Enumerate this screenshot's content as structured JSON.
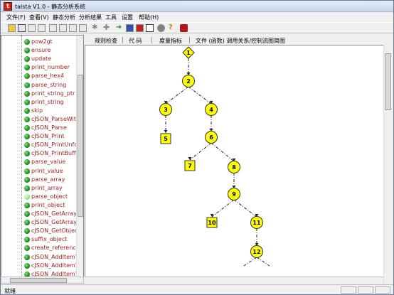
{
  "window": {
    "title": "talsta V1.0 - 静态分析系统",
    "icon": "app-icon"
  },
  "menu": [
    "文件(F)",
    "查看(V)",
    "静态分析",
    "分析结果",
    "工具",
    "设置",
    "帮助(H)"
  ],
  "toolbar": {
    "icons": [
      "open-folder-icon",
      "save-icon",
      "new-doc-icon",
      "print-icon",
      "copy-icon",
      "paste-icon",
      "cut-icon",
      "find-icon",
      "settings-star-icon",
      "plus-icon",
      "arrow-icon",
      "table-icon",
      "grid-icon",
      "record-icon",
      "circle-icon",
      "help-icon",
      "exit-icon"
    ]
  },
  "tree": {
    "items": [
      "pow2gt",
      "ensure",
      "update",
      "print_number",
      "parse_hex4",
      "parse_string",
      "print_string_ptr",
      "print_string",
      "skip",
      "cJSON_ParseWithO",
      "cJSON_Parse",
      "cJSON_Print",
      "cJSON_PrintUnfor",
      "cJSON_PrintBuffer",
      "parse_value",
      "print_value",
      "parse_array",
      "print_array",
      "parse_object",
      "print_object",
      "cJSON_GetArraySi",
      "cJSON_GetArrayIte",
      "cJSON_GetObjectI",
      "suffix_object",
      "create_reference",
      "cJSON_AddItemTo",
      "cJSON_AddItemTo",
      "cJSON_AddItemTo"
    ],
    "selected": "parse_object"
  },
  "tabs": [
    "规则检查",
    "代  码",
    "度量指标",
    "文件 (函数) 调用关系/控制流图简图"
  ],
  "flow": {
    "nodes": [
      {
        "id": "1",
        "shape": "diamond"
      },
      {
        "id": "2",
        "shape": "circle"
      },
      {
        "id": "3",
        "shape": "circle"
      },
      {
        "id": "4",
        "shape": "circle"
      },
      {
        "id": "5",
        "shape": "square"
      },
      {
        "id": "6",
        "shape": "circle"
      },
      {
        "id": "7",
        "shape": "square"
      },
      {
        "id": "8",
        "shape": "circle"
      },
      {
        "id": "9",
        "shape": "circle"
      },
      {
        "id": "10",
        "shape": "square"
      },
      {
        "id": "11",
        "shape": "circle"
      },
      {
        "id": "12",
        "shape": "circle"
      }
    ],
    "edges": [
      [
        "1",
        "2"
      ],
      [
        "2",
        "3"
      ],
      [
        "2",
        "4"
      ],
      [
        "3",
        "5"
      ],
      [
        "4",
        "6"
      ],
      [
        "6",
        "7"
      ],
      [
        "6",
        "8"
      ],
      [
        "8",
        "9"
      ],
      [
        "9",
        "10"
      ],
      [
        "9",
        "11"
      ],
      [
        "11",
        "12"
      ]
    ],
    "fill": "#ffff00",
    "stroke": "#333333"
  },
  "status": {
    "text": "就绪"
  }
}
